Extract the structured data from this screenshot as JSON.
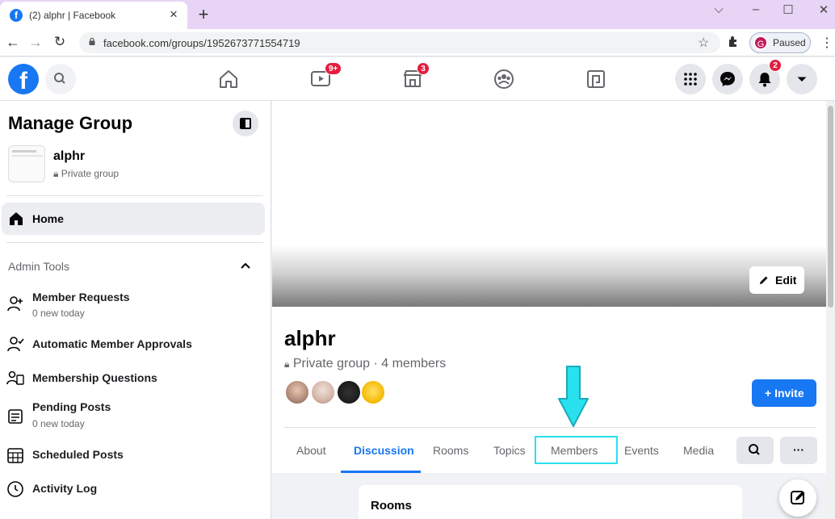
{
  "browser": {
    "tab_title": "(2) alphr | Facebook",
    "tab_close": "×",
    "new_tab": "+",
    "window_controls": {
      "chevron": "⌵",
      "minimize": "–",
      "maximize": "☐",
      "close": "✕"
    },
    "url": "facebook.com/groups/1952673771554719",
    "profile_initial": "G",
    "profile_status": "Paused"
  },
  "fb_nav": {
    "logo": "f",
    "badges": {
      "watch": "9+",
      "marketplace": "3",
      "notifications": "2"
    }
  },
  "sidebar": {
    "title": "Manage Group",
    "group_name": "alphr",
    "group_privacy": "Private group",
    "home_label": "Home",
    "admin_tools_label": "Admin Tools",
    "items": [
      {
        "label": "Member Requests",
        "sub": "0 new today",
        "icon": "member-requests-icon"
      },
      {
        "label": "Automatic Member Approvals",
        "sub": "",
        "icon": "auto-approvals-icon"
      },
      {
        "label": "Membership Questions",
        "sub": "",
        "icon": "membership-questions-icon"
      },
      {
        "label": "Pending Posts",
        "sub": "0 new today",
        "icon": "pending-posts-icon"
      },
      {
        "label": "Scheduled Posts",
        "sub": "",
        "icon": "calendar-icon"
      },
      {
        "label": "Activity Log",
        "sub": "",
        "icon": "clock-icon"
      }
    ]
  },
  "group": {
    "edit_label": "Edit",
    "title": "alphr",
    "meta": "Private group · 4 members",
    "invite_label": "+ Invite",
    "tabs": [
      "About",
      "Discussion",
      "Rooms",
      "Topics",
      "Members",
      "Events",
      "Media"
    ],
    "active_tab": "Discussion",
    "highlighted_tab": "Members",
    "more_label": "···",
    "rooms_label": "Rooms"
  },
  "colors": {
    "brand": "#1877f2",
    "badge": "#e41e3f",
    "highlight": "#29e0ef",
    "tabstrip": "#e8d5f5"
  }
}
